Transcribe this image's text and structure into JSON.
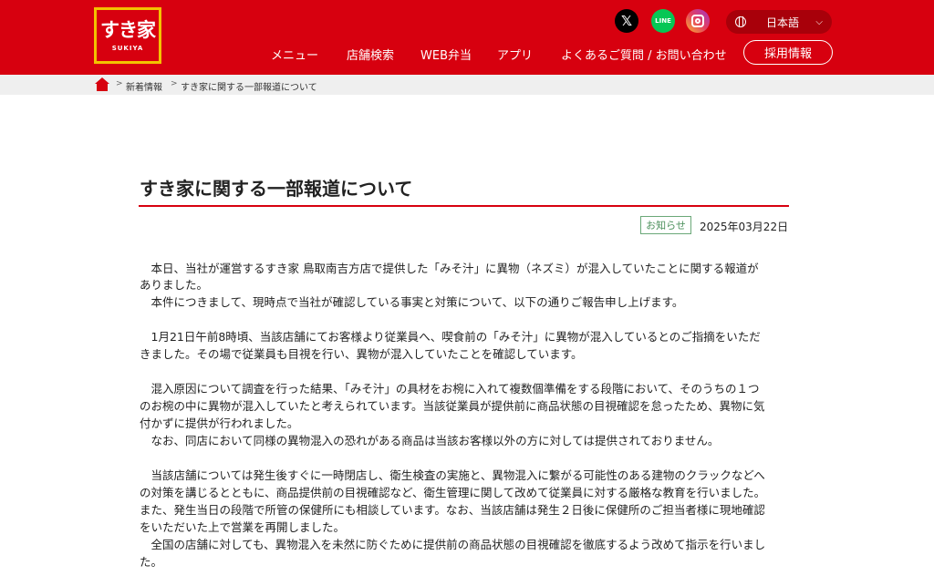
{
  "header": {
    "logo": {
      "main": "すき家",
      "sub": "SUKIYA"
    },
    "social": {
      "x": "𝕏",
      "line": "LINE"
    },
    "language": {
      "label": "日本語"
    },
    "nav": [
      {
        "label": "メニュー"
      },
      {
        "label": "店舗検索"
      },
      {
        "label": "WEB弁当"
      },
      {
        "label": "アプリ"
      },
      {
        "label": "よくあるご質問 / お問い合わせ"
      }
    ],
    "recruit_label": "採用情報"
  },
  "breadcrumb": {
    "items": [
      "新着情報",
      "すき家に関する一部報道について"
    ]
  },
  "article": {
    "title": "すき家に関する一部報道について",
    "category": "お知らせ",
    "date": "2025年03月22日",
    "lines": [
      "　本日、当社が運営するすき家 鳥取南吉方店で提供した「みそ汁」に異物（ネズミ）が混入していたことに関する報道が",
      "ありました。",
      "　本件につきまして、現時点で当社が確認している事実と対策について、以下の通りご報告申し上げます。",
      "　1月21日午前8時頃、当該店舗にてお客様より従業員へ、喫食前の「みそ汁」に異物が混入しているとのご指摘をいただ",
      "きました。その場で従業員も目視を行い、異物が混入していたことを確認しています。",
      "　混入原因について調査を行った結果、「みそ汁」の具材をお椀に入れて複数個準備をする段階において、そのうちの１つ",
      "のお椀の中に異物が混入していたと考えられています。当該従業員が提供前に商品状態の目視確認を怠ったため、異物に気",
      "付かずに提供が行われました。",
      "　なお、同店において同様の異物混入の恐れがある商品は当該お客様以外の方に対しては提供されておりません。",
      "　当該店舗については発生後すぐに一時閉店し、衛生検査の実施と、異物混入に繋がる可能性のある建物のクラックなどへ",
      "の対策を講じるとともに、商品提供前の目視確認など、衛生管理に関して改めて従業員に対する厳格な教育を行いました。",
      "また、発生当日の段階で所管の保健所にも相談しています。なお、当該店舗は発生２日後に保健所のご担当者様に現地確認",
      "をいただいた上で営業を再開しました。",
      "　全国の店舗に対しても、異物混入を未然に防ぐために提供前の商品状態の目視確認を徹底するよう改めて指示を行いまし",
      "た。"
    ]
  },
  "colors": {
    "brand_red": "#d7000f",
    "logo_yellow": "#f3c200",
    "badge_green": "#4a8f5a"
  }
}
